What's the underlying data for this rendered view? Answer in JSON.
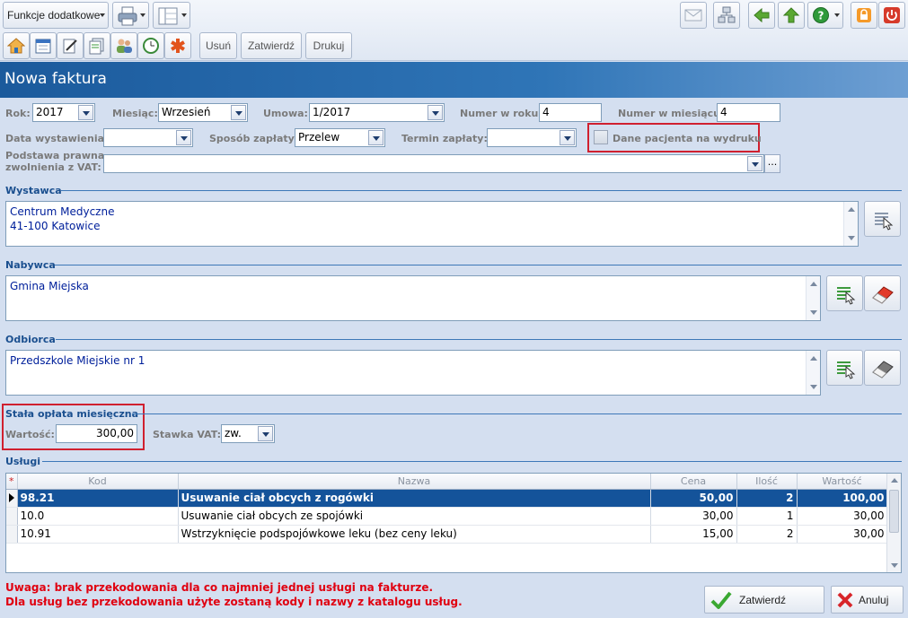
{
  "toolbar": {
    "extra_functions_label": "Funkcje dodatkowe",
    "delete_label": "Usuń",
    "approve_label": "Zatwierdź",
    "print_label": "Drukuj"
  },
  "page_title": "Nowa faktura",
  "form": {
    "year_label": "Rok:",
    "year_value": "2017",
    "month_label": "Miesiąc:",
    "month_value": "Wrzesień",
    "contract_label": "Umowa:",
    "contract_value": "1/2017",
    "year_number_label": "Numer w roku:",
    "year_number_value": "4",
    "month_number_label": "Numer w miesiącu:",
    "month_number_value": "4",
    "issue_date_label": "Data wystawienia:",
    "issue_date_value": "",
    "payment_method_label": "Sposób zapłaty:",
    "payment_method_value": "Przelew",
    "payment_term_label": "Termin zapłaty:",
    "payment_term_value": "",
    "patient_data_label": "Dane pacjenta na wydruku",
    "vat_basis_label_1": "Podstawa prawna",
    "vat_basis_label_2": "zwolnienia z VAT:",
    "vat_basis_value": "",
    "ellipsis": "..."
  },
  "issuer": {
    "title": "Wystawca",
    "line1": "Centrum Medyczne",
    "line2": "41-100 Katowice"
  },
  "buyer": {
    "title": "Nabywca",
    "line1": "Gmina Miejska"
  },
  "recipient": {
    "title": "Odbiorca",
    "line1": "Przedszkole Miejskie nr 1"
  },
  "monthly_fee": {
    "title": "Stała opłata miesięczna",
    "value_label": "Wartość:",
    "value": "300,00",
    "vat_label": "Stawka VAT:",
    "vat_value": "zw."
  },
  "services": {
    "title": "Usługi",
    "columns": {
      "star": "*",
      "code": "Kod",
      "name": "Nazwa",
      "price": "Cena",
      "qty": "Ilość",
      "value": "Wartość"
    },
    "rows": [
      {
        "code": "98.21",
        "name": "Usuwanie ciał obcych z rogówki",
        "price": "50,00",
        "qty": "2",
        "value": "100,00"
      },
      {
        "code": "10.0",
        "name": "Usuwanie ciał obcych ze spojówki",
        "price": "30,00",
        "qty": "1",
        "value": "30,00"
      },
      {
        "code": "10.91",
        "name": "Wstrzyknięcie podspojówkowe leku (bez ceny leku)",
        "price": "15,00",
        "qty": "2",
        "value": "30,00"
      }
    ]
  },
  "warning": {
    "line1": "Uwaga: brak przekodowania dla co najmniej jednej usługi na fakturze.",
    "line2": "Dla usług bez przekodowania użyte zostaną kody i nazwy z katalogu usług."
  },
  "actions": {
    "confirm_label": "Zatwierdź",
    "cancel_label": "Anuluj"
  },
  "colors": {
    "accent": "#1b5a9c",
    "selected_row": "#14539a",
    "warning": "#e00010",
    "highlight_box": "#d0202f"
  }
}
